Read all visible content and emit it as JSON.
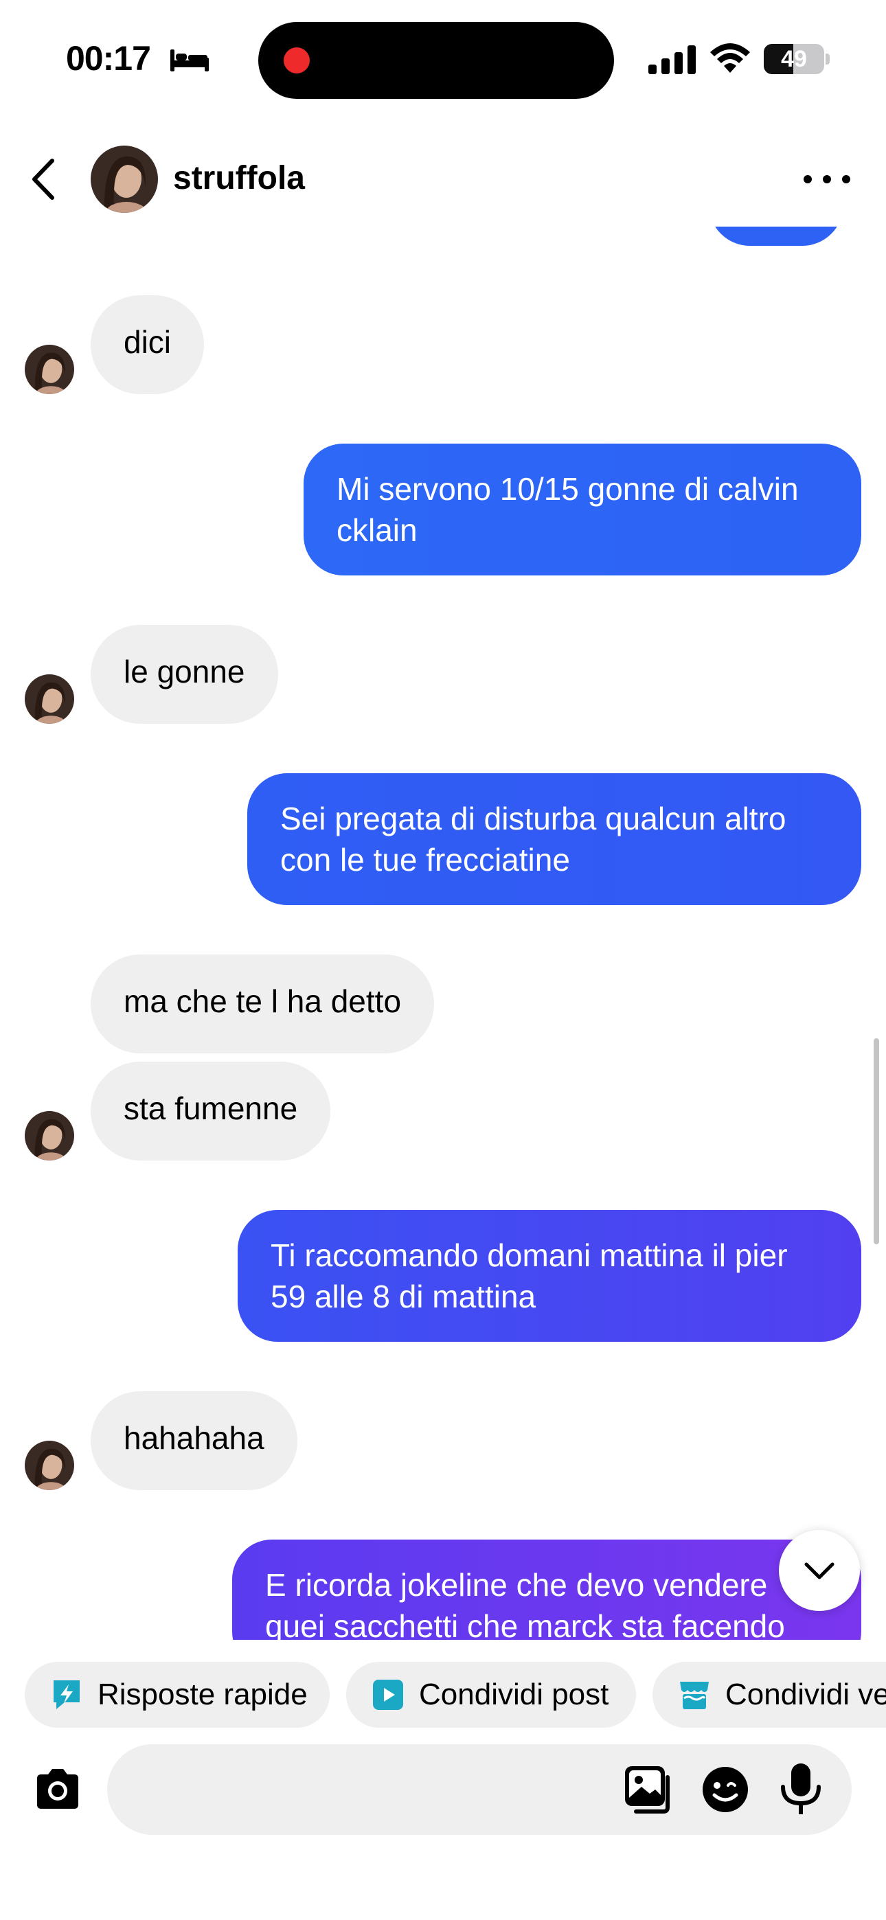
{
  "status_bar": {
    "time": "00:17",
    "battery": "49",
    "battery_level": 0.49
  },
  "header": {
    "username": "struffola"
  },
  "messages": [
    {
      "text": "dici"
    },
    {
      "text": "Mi servono 10/15 gonne di calvin cklain"
    },
    {
      "text": "le gonne"
    },
    {
      "text": "Sei pregata di disturba qualcun altro con le tue frecciatine"
    },
    {
      "text": "ma che te l ha detto"
    },
    {
      "text": "sta fumenne"
    },
    {
      "text": "Ti raccomando domani mattina il pier 59 alle 8 di mattina"
    },
    {
      "text": "hahahaha"
    },
    {
      "text": "E ricorda jokeline che devo vendere quei sacchetti che marck sta facendo"
    }
  ],
  "quick_actions": [
    {
      "label": "Risposte rapide",
      "icon": "lightning-icon",
      "color": "#1aa8c4"
    },
    {
      "label": "Condividi post",
      "icon": "play-icon",
      "color": "#1aa8c4"
    },
    {
      "label": "Condividi ve",
      "icon": "shop-icon",
      "color": "#1aa8c4"
    }
  ],
  "composer": {
    "placeholder": ""
  },
  "colors": {
    "bubble_blue": "#2d62f5",
    "bubble_violet": "#6b3af0",
    "bubble_incoming": "#efefef",
    "accent": "#1aa8c4"
  }
}
